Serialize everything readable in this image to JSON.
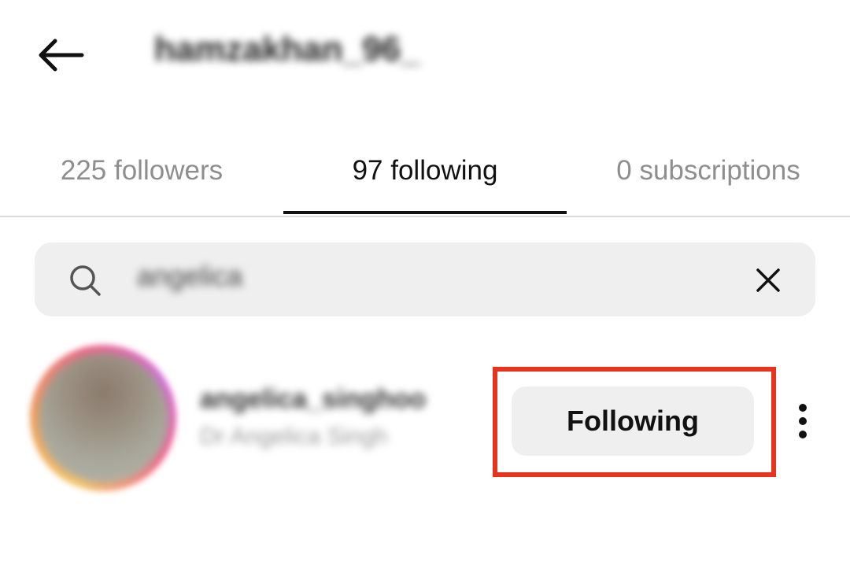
{
  "header": {
    "back_icon": "arrow-left-icon",
    "username": "hamzakhan_96_"
  },
  "tabs": [
    {
      "label": "225 followers",
      "active": false
    },
    {
      "label": "97 following",
      "active": true
    },
    {
      "label": "0 subscriptions",
      "active": false
    }
  ],
  "search": {
    "icon": "search-icon",
    "value": "angelica",
    "clear_icon": "close-icon"
  },
  "results": [
    {
      "handle": "angelica_singhoo",
      "full_name": "Dr Angelica Singh",
      "button_label": "Following",
      "more_icon": "more-vertical-icon"
    }
  ],
  "colors": {
    "highlight": "#e8341c",
    "button_bg": "#efefef",
    "inactive_tab": "#8e8e8e"
  }
}
